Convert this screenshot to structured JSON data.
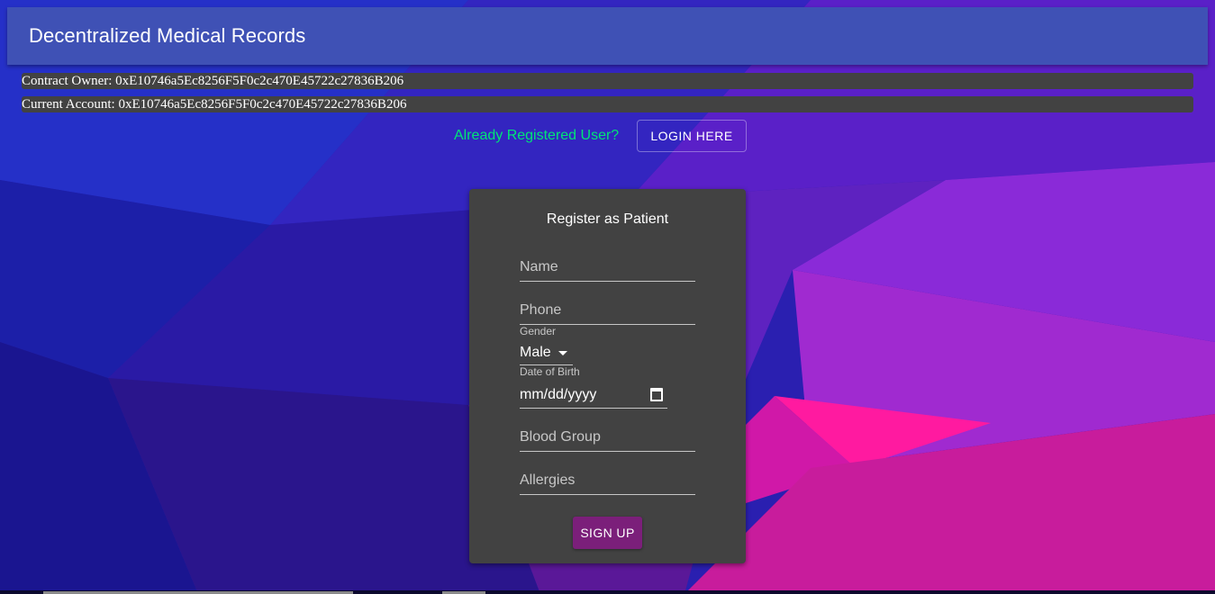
{
  "colors": {
    "appbar": "#3f51b5",
    "panel": "#424242",
    "login_prompt": "#00e676",
    "signup_button": "#7b1f7a"
  },
  "appbar": {
    "title": "Decentralized Medical Records"
  },
  "accounts": {
    "owner_label": "Contract Owner: 0xE10746a5Ec8256F5F0c2c470E45722c27836B206",
    "current_label": "Current Account: 0xE10746a5Ec8256F5F0c2c470E45722c27836B206"
  },
  "login": {
    "prompt": "Already Registered User?",
    "button_label": "LOGIN HERE"
  },
  "register_form": {
    "title": "Register as Patient",
    "name_placeholder": "Name",
    "phone_placeholder": "Phone",
    "gender_label": "Gender",
    "gender_value": "Male",
    "dob_label": "Date of Birth",
    "dob_placeholder": "mm/dd/yyyy",
    "blood_group_placeholder": "Blood Group",
    "allergies_placeholder": "Allergies",
    "submit_label": "SIGN UP"
  }
}
